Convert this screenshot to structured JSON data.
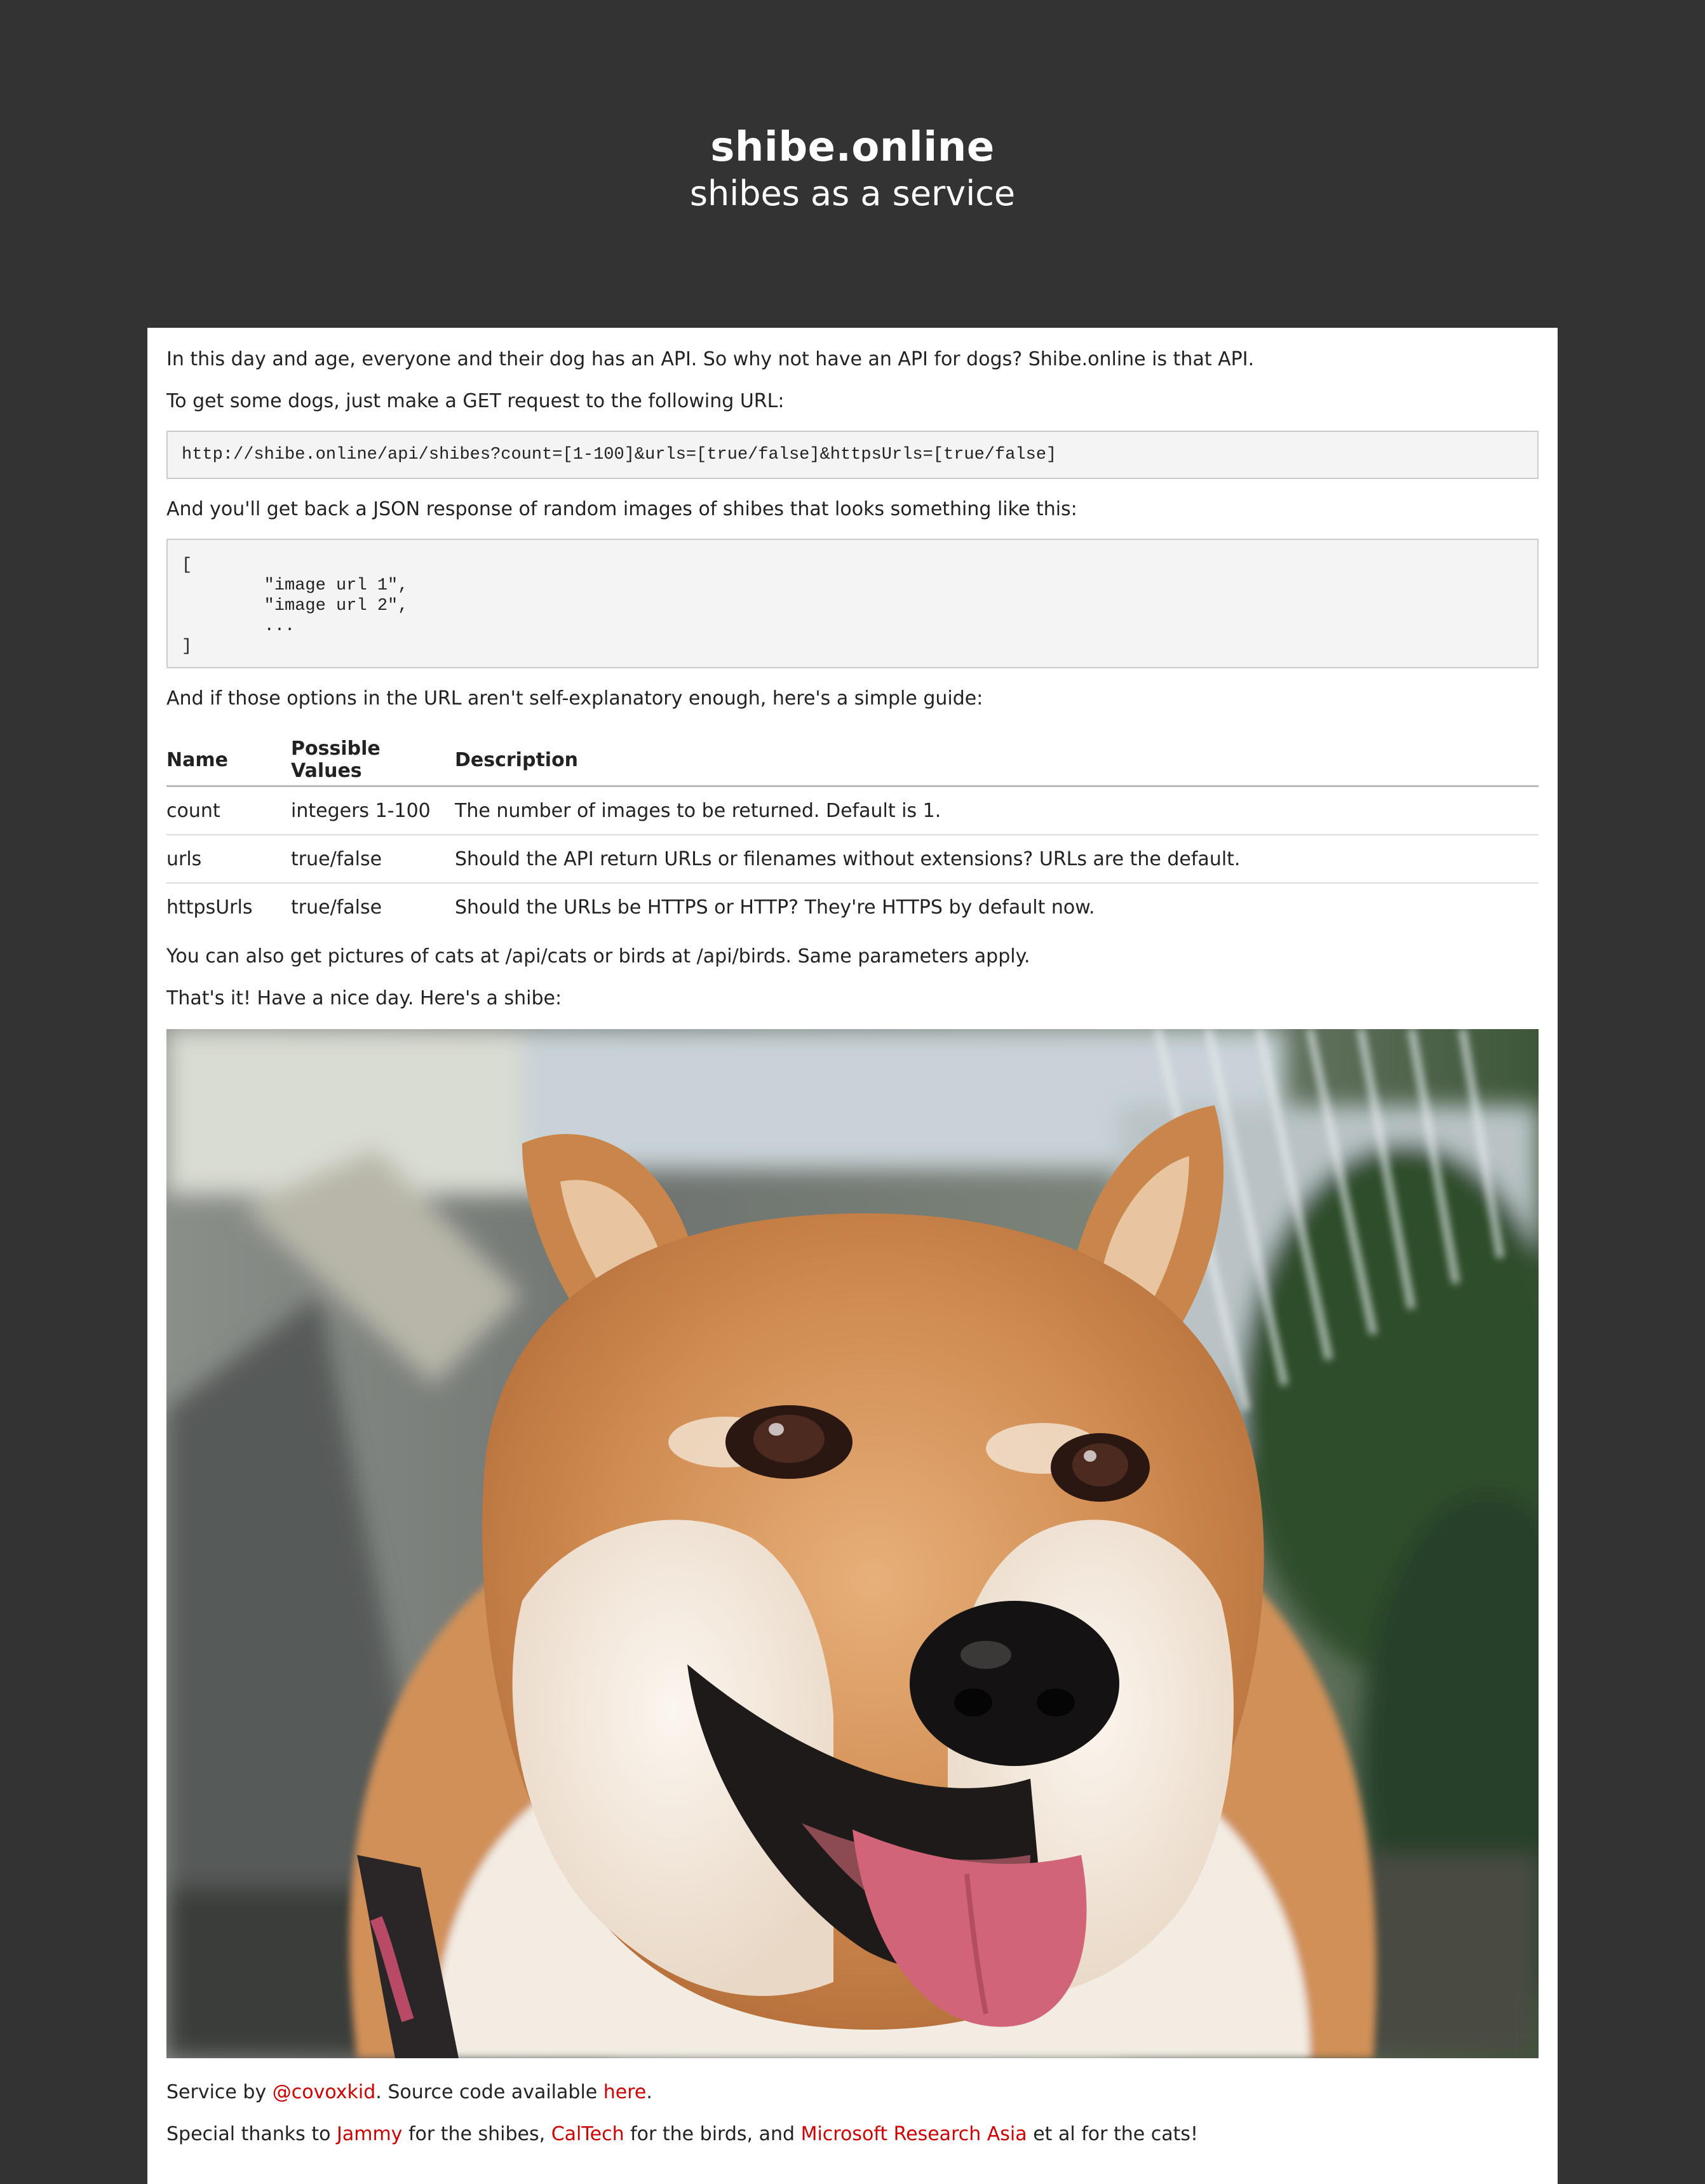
{
  "header": {
    "title": "shibe.online",
    "subtitle": "shibes as a service"
  },
  "intro": {
    "line1": "In this day and age, everyone and their dog has an API. So why not have an API for dogs? Shibe.online is that API.",
    "line2": "To get some dogs, just make a GET request to the following URL:",
    "request_url": "http://shibe.online/api/shibes?count=[1-100]&urls=[true/false]&httpsUrls=[true/false]",
    "line3": "And you'll get back a JSON response of random images of shibes that looks something like this:",
    "json_example": "[\n        \"image url 1\",\n        \"image url 2\",\n        ...\n]",
    "line4": "And if those options in the URL aren't self-explanatory enough, here's a simple guide:"
  },
  "guide_table": {
    "headers": [
      "Name",
      "Possible Values",
      "Description"
    ],
    "rows": [
      [
        "count",
        "integers 1-100",
        "The number of images to be returned. Default is 1."
      ],
      [
        "urls",
        "true/false",
        "Should the API return URLs or filenames without extensions? URLs are the default."
      ],
      [
        "httpsUrls",
        "true/false",
        "Should the URLs be HTTPS or HTTP? They're HTTPS by default now."
      ]
    ]
  },
  "outro": {
    "line1": "You can also get pictures of cats at /api/cats or birds at /api/birds. Same parameters apply.",
    "line2": "That's it! Have a nice day. Here's a shibe:"
  },
  "footer": {
    "service_prefix": "Service by ",
    "author_link": "@covoxkid",
    "source_prefix": ". Source code available ",
    "source_link": "here",
    "source_suffix": ".",
    "thanks_prefix": "Special thanks to ",
    "jammy_link": "Jammy",
    "thanks_mid1": " for the shibes, ",
    "caltech_link": "CalTech",
    "thanks_mid2": " for the birds, and ",
    "msra_link": "Microsoft Research Asia",
    "thanks_suffix": " et al for the cats!"
  },
  "colors": {
    "background": "#333333",
    "link": "#cc0000",
    "code_background": "#f4f4f4"
  }
}
